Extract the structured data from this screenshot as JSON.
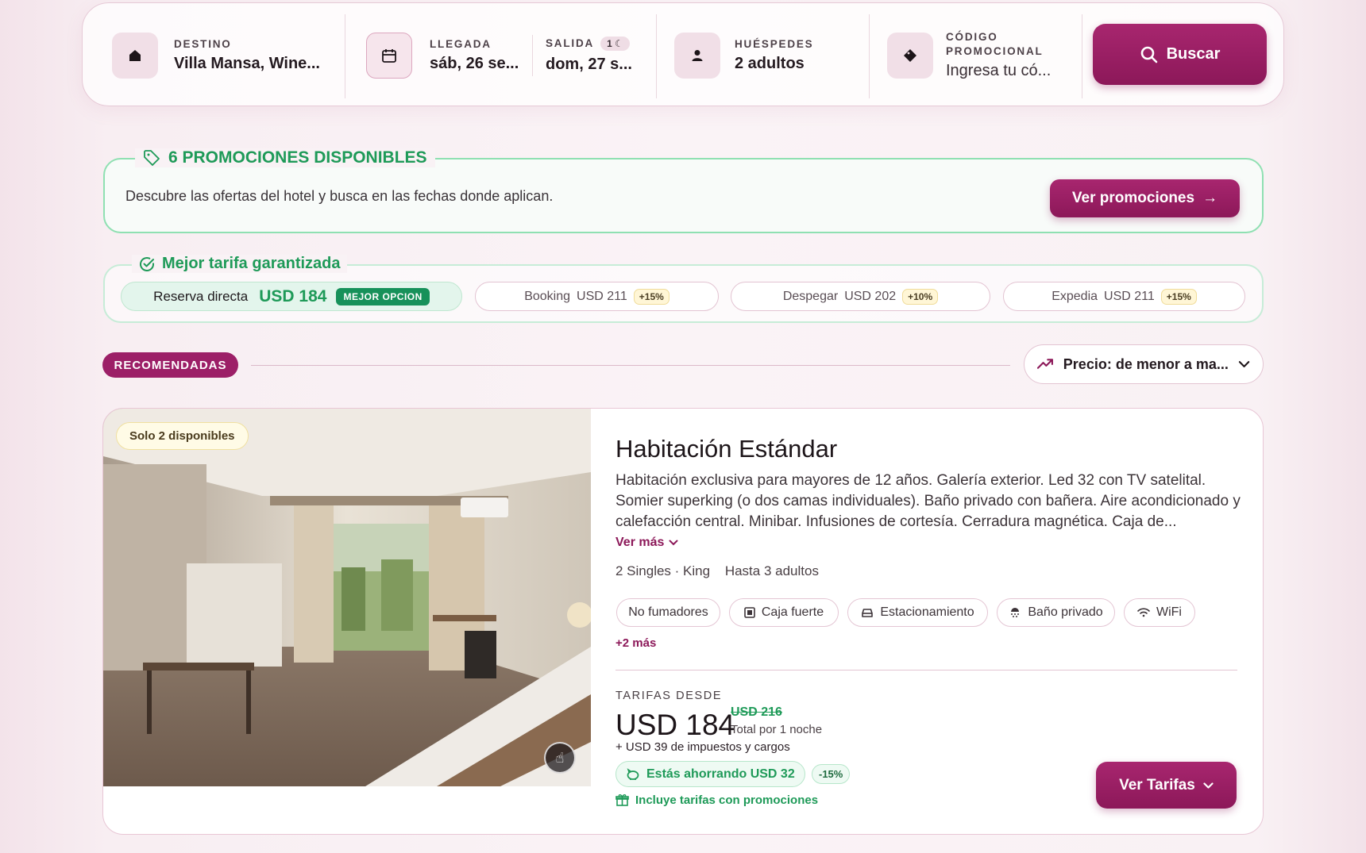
{
  "search": {
    "destino_label": "DESTINO",
    "destino_value": "Villa Mansa, Wine...",
    "llegada_label": "LLEGADA",
    "llegada_value": "sáb, 26 se...",
    "salida_label": "SALIDA",
    "salida_nights": "1",
    "salida_value": "dom, 27 s...",
    "huespedes_label": "HUÉSPEDES",
    "huespedes_value": "2 adultos",
    "codigo_label": "CÓDIGO PROMOCIONAL",
    "codigo_placeholder": "Ingresa tu có...",
    "search_button": "Buscar"
  },
  "promotions": {
    "title": "6 PROMOCIONES DISPONIBLES",
    "text": "Descubre las ofertas del hotel y busca en las fechas donde aplican.",
    "button": "Ver promociones"
  },
  "best_rate": {
    "title": "Mejor tarifa garantizada",
    "direct": {
      "label": "Reserva directa",
      "price": "USD 184",
      "badge": "MEJOR OPCION"
    },
    "competitors": [
      {
        "name": "Booking",
        "price": "USD 211",
        "pct": "+15%"
      },
      {
        "name": "Despegar",
        "price": "USD 202",
        "pct": "+10%"
      },
      {
        "name": "Expedia",
        "price": "USD 211",
        "pct": "+15%"
      }
    ]
  },
  "list": {
    "badge": "RECOMENDADAS",
    "sort_label": "Precio: de menor a ma..."
  },
  "room": {
    "availability": "Solo 2 disponibles",
    "title": "Habitación Estándar",
    "description": "Habitación exclusiva para mayores de 12 años. Galería exterior. Led 32 con TV satelital. Somier superking (o dos camas individuales). Baño privado con bañera. Aire acondicionado y calefacción central. Minibar. Infusiones de cortesía. Cerradura magnética. Caja de...",
    "ver_mas": "Ver más",
    "beds": "2 Singles · King",
    "capacity": "Hasta 3 adultos",
    "amenities": [
      "No fumadores",
      "Caja fuerte",
      "Estacionamiento",
      "Baño privado",
      "WiFi"
    ],
    "more_amenities": "+2 más",
    "from_label": "TARIFAS DESDE",
    "price": "USD 184",
    "old_price": "USD 216",
    "per_night": "Total por 1 noche",
    "taxes": "+ USD 39 de impuestos y cargos",
    "saving": "Estás ahorrando USD 32",
    "saving_pct": "-15%",
    "includes": "Incluye tarifas con promociones",
    "button": "Ver Tarifas"
  },
  "colors": {
    "brand": "#9c1f67",
    "green": "#1e9a58"
  }
}
